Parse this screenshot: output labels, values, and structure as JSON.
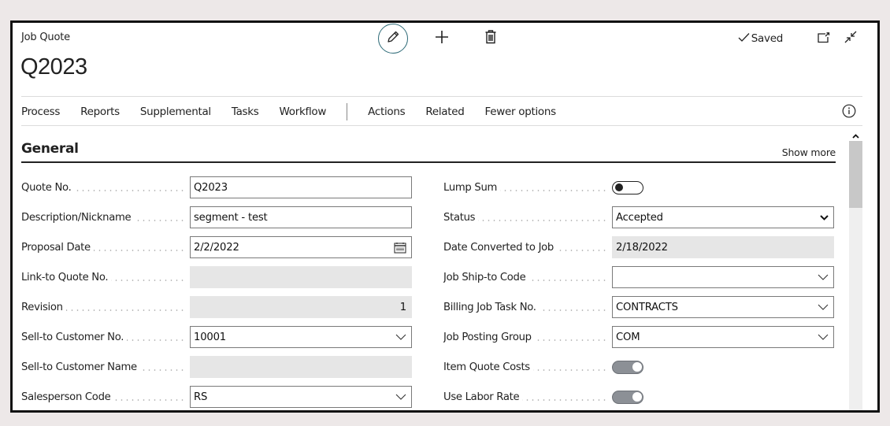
{
  "header": {
    "caption": "Job Quote",
    "title": "Q2023",
    "saved_label": "Saved",
    "actions": [
      {
        "name": "edit-button",
        "icon": "pencil-icon"
      },
      {
        "name": "new-button",
        "icon": "plus-icon"
      },
      {
        "name": "delete-button",
        "icon": "trash-icon"
      }
    ],
    "right_icons": [
      "open-in-new-window-icon",
      "collapse-icon"
    ]
  },
  "menu": {
    "items_left": [
      "Process",
      "Reports",
      "Supplemental",
      "Tasks",
      "Workflow"
    ],
    "items_right": [
      "Actions",
      "Related",
      "Fewer options"
    ],
    "info_icon": "info-icon"
  },
  "section": {
    "title": "General",
    "show_more": "Show more"
  },
  "left_fields": [
    {
      "label": "Quote No.",
      "value": "Q2023",
      "type": "text"
    },
    {
      "label": "Description/Nickname",
      "value": "segment - test",
      "type": "text"
    },
    {
      "label": "Proposal Date",
      "value": "2/2/2022",
      "type": "date"
    },
    {
      "label": "Link-to Quote No.",
      "value": "",
      "type": "readonly"
    },
    {
      "label": "Revision",
      "value": "1",
      "type": "readonly-number"
    },
    {
      "label": "Sell-to Customer No.",
      "value": "10001",
      "type": "lookup"
    },
    {
      "label": "Sell-to Customer Name",
      "value": "",
      "type": "readonly"
    },
    {
      "label": "Salesperson Code",
      "value": "RS",
      "type": "lookup"
    }
  ],
  "right_fields": [
    {
      "label": "Lump Sum",
      "type": "toggle",
      "checked": false
    },
    {
      "label": "Status",
      "value": "Accepted",
      "type": "option"
    },
    {
      "label": "Date Converted to Job",
      "value": "2/18/2022",
      "type": "readonly"
    },
    {
      "label": "Job Ship-to Code",
      "value": "",
      "type": "lookup"
    },
    {
      "label": "Billing Job Task No.",
      "value": "CONTRACTS",
      "type": "lookup"
    },
    {
      "label": "Job Posting Group",
      "value": "COM",
      "type": "lookup"
    },
    {
      "label": "Item Quote Costs",
      "type": "toggle",
      "checked": true
    },
    {
      "label": "Use Labor Rate",
      "type": "toggle",
      "checked": true
    }
  ],
  "colors": {
    "background": "#ede8e8",
    "accent_ring": "#2d6a77",
    "readonly_fill": "#e6e6e6",
    "toggle_on": "#8c9096"
  }
}
